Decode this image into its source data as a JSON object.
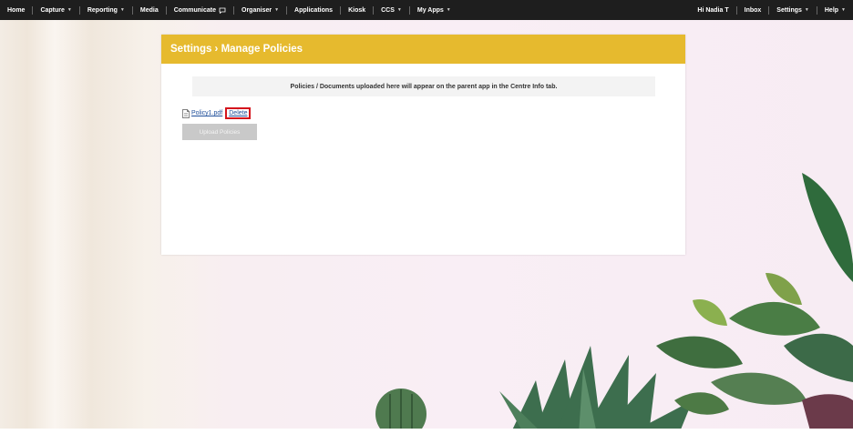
{
  "nav": {
    "left": [
      {
        "label": "Home",
        "dropdown": false
      },
      {
        "label": "Capture",
        "dropdown": true
      },
      {
        "label": "Reporting",
        "dropdown": true
      },
      {
        "label": "Media",
        "dropdown": false
      },
      {
        "label": "Communicate",
        "dropdown": false,
        "icon": "chat-icon"
      },
      {
        "label": "Organiser",
        "dropdown": true
      },
      {
        "label": "Applications",
        "dropdown": false
      },
      {
        "label": "Kiosk",
        "dropdown": false
      },
      {
        "label": "CCS",
        "dropdown": true
      },
      {
        "label": "My Apps",
        "dropdown": true
      }
    ],
    "right": [
      {
        "label": "Hi Nadia T",
        "dropdown": false
      },
      {
        "label": "Inbox",
        "dropdown": false
      },
      {
        "label": "Settings",
        "dropdown": true
      },
      {
        "label": "Help",
        "dropdown": true
      }
    ]
  },
  "card": {
    "title": "Settings › Manage Policies",
    "info": "Policies / Documents uploaded here will appear on the parent app in the Centre Info tab.",
    "file_name": "Policy1.pdf",
    "delete_label": "Delete",
    "upload_label": "Upload Policies"
  },
  "colors": {
    "header": "#e6ba2e",
    "navbar": "#1e1e1e",
    "highlight": "#d4151d",
    "link": "#1f4f9a"
  }
}
